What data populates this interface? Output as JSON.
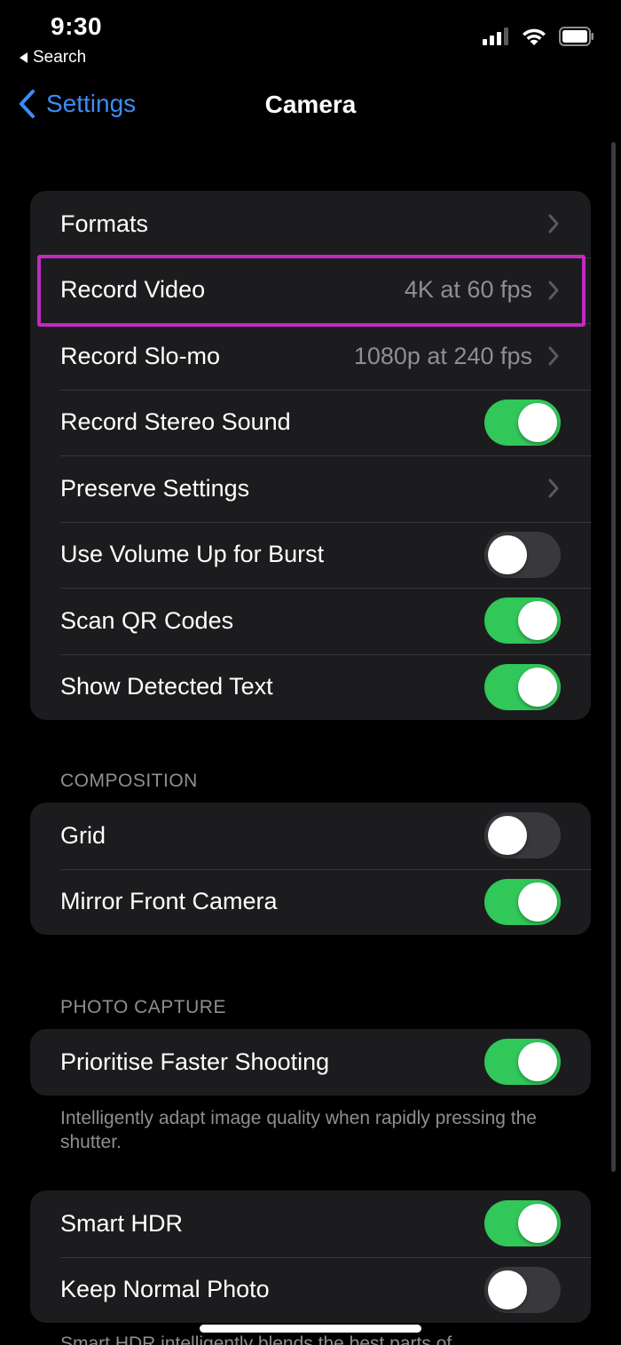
{
  "status_bar": {
    "time": "9:30",
    "back_app_label": "Search",
    "icons": [
      "cellular-signal-icon",
      "wifi-icon",
      "battery-icon"
    ]
  },
  "nav": {
    "back_label": "Settings",
    "title": "Camera"
  },
  "colors": {
    "accent": "#3b8cf6",
    "toggle_on": "#31c759",
    "highlight": "#c02bc2"
  },
  "group_main": [
    {
      "label": "Formats",
      "type": "chevron"
    },
    {
      "label": "Record Video",
      "value": "4K at 60 fps",
      "type": "chevron",
      "highlighted": true
    },
    {
      "label": "Record Slo-mo",
      "value": "1080p at 240 fps",
      "type": "chevron"
    },
    {
      "label": "Record Stereo Sound",
      "type": "toggle",
      "on": true
    },
    {
      "label": "Preserve Settings",
      "type": "chevron"
    },
    {
      "label": "Use Volume Up for Burst",
      "type": "toggle",
      "on": false
    },
    {
      "label": "Scan QR Codes",
      "type": "toggle",
      "on": true
    },
    {
      "label": "Show Detected Text",
      "type": "toggle",
      "on": true
    }
  ],
  "composition": {
    "header": "COMPOSITION",
    "rows": [
      {
        "label": "Grid",
        "type": "toggle",
        "on": false
      },
      {
        "label": "Mirror Front Camera",
        "type": "toggle",
        "on": true
      }
    ]
  },
  "photo_capture": {
    "header": "PHOTO CAPTURE",
    "rows": [
      {
        "label": "Prioritise Faster Shooting",
        "type": "toggle",
        "on": true
      }
    ],
    "footnote": "Intelligently adapt image quality when rapidly pressing the shutter."
  },
  "hdr": {
    "rows": [
      {
        "label": "Smart HDR",
        "type": "toggle",
        "on": true
      },
      {
        "label": "Keep Normal Photo",
        "type": "toggle",
        "on": false
      }
    ],
    "footnote_partial": "Smart HDR intelligently blends the best parts of"
  }
}
